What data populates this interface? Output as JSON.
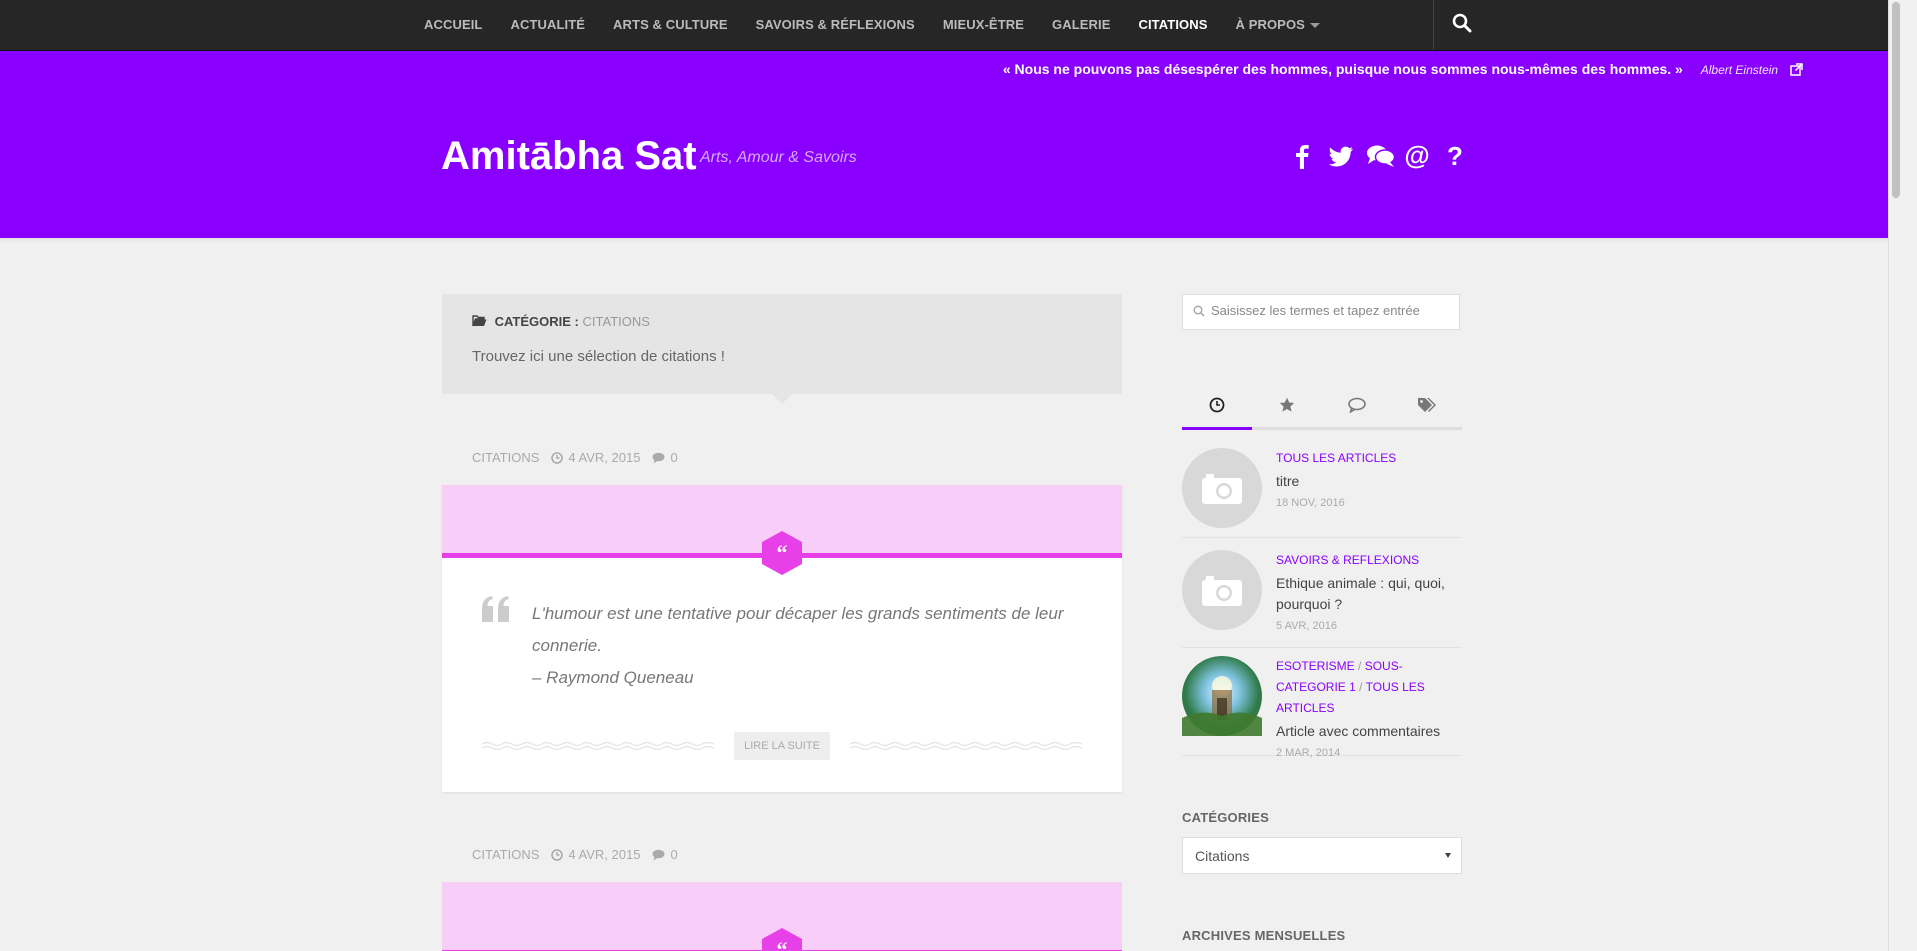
{
  "nav": {
    "items": [
      "ACCUEIL",
      "ACTUALITÉ",
      "ARTS & CULTURE",
      "SAVOIRS & RÉFLEXIONS",
      "MIEUX-ÊTRE",
      "GALERIE",
      "CITATIONS",
      "À PROPOS"
    ],
    "active": "CITATIONS"
  },
  "header": {
    "quote": "« Nous ne pouvons pas désespérer des hommes, puisque nous sommes nous-mêmes des hommes. »",
    "quote_author": "Albert Einstein",
    "site_title": "Amitābha Sat",
    "tagline": "Arts, Amour & Savoirs",
    "social_icons": [
      "facebook-icon",
      "twitter-icon",
      "comments-icon",
      "at-icon",
      "question-icon"
    ]
  },
  "category": {
    "label": "CATÉGORIE :",
    "name": "CITATIONS",
    "description": "Trouvez ici une sélection de citations !"
  },
  "posts": [
    {
      "category": "CITATIONS",
      "date": "4 AVR, 2015",
      "comments": "0",
      "quote_lines": [
        "L'humour est une tentative pour décaper les grands sentiments de leur",
        "connerie.",
        "– Raymond Queneau"
      ],
      "read_more": "LIRE LA SUITE"
    },
    {
      "category": "CITATIONS",
      "date": "4 AVR, 2015",
      "comments": "0"
    }
  ],
  "sidebar": {
    "search_placeholder": "Saisissez les termes et tapez entrée",
    "tabs": [
      "clock-icon",
      "star-icon",
      "comment-icon",
      "tags-icon"
    ],
    "articles": [
      {
        "cats": [
          "TOUS LES ARTICLES"
        ],
        "title": "titre",
        "date": "18 NOV, 2016"
      },
      {
        "cats": [
          "SAVOIRS & REFLEXIONS"
        ],
        "title": "Ethique animale : qui, quoi, pourquoi ?",
        "date": "5 AVR, 2016"
      },
      {
        "cats_line1": "ESOTERISME",
        "cats_line1b": "SOUS-CATEGORIE",
        "cats_line2": "1",
        "cats_line2b": "TOUS LES ARTICLES",
        "title": "Article avec commentaires",
        "date": "2 MAR, 2014"
      }
    ],
    "categories_title": "CATÉGORIES",
    "categories_selected": "Citations",
    "archives_title": "ARCHIVES MENSUELLES"
  },
  "colors": {
    "accent": "#8a00ff",
    "quote_band": "#f8cdf8",
    "quote_accent": "#e840e8",
    "nav_bg": "#262626"
  }
}
